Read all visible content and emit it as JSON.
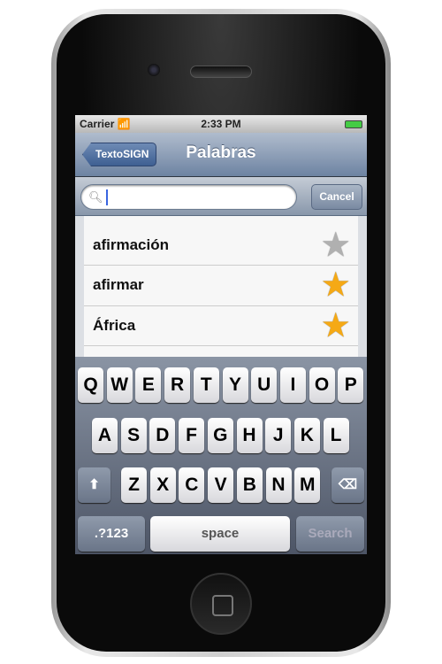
{
  "status": {
    "carrier": "Carrier",
    "time": "2:33 PM"
  },
  "nav": {
    "back_label": "TextoSIGN",
    "title": "Palabras"
  },
  "search": {
    "value": "",
    "cancel_label": "Cancel"
  },
  "list": {
    "items": [
      {
        "word": "afirmación",
        "favorite": false
      },
      {
        "word": "afirmar",
        "favorite": true
      },
      {
        "word": "África",
        "favorite": true
      }
    ]
  },
  "colors": {
    "star_on": "#f5a915",
    "star_off": "#b0b0b0",
    "caret": "#3a66e0"
  },
  "keyboard": {
    "row1": [
      "Q",
      "W",
      "E",
      "R",
      "T",
      "Y",
      "U",
      "I",
      "O",
      "P"
    ],
    "row2": [
      "A",
      "S",
      "D",
      "F",
      "G",
      "H",
      "J",
      "K",
      "L"
    ],
    "row3": [
      "Z",
      "X",
      "C",
      "V",
      "B",
      "N",
      "M"
    ],
    "shift_icon": "shift-arrow-icon",
    "delete_icon": "backspace-icon",
    "numbers_label": ".?123",
    "space_label": "space",
    "search_label": "Search"
  }
}
